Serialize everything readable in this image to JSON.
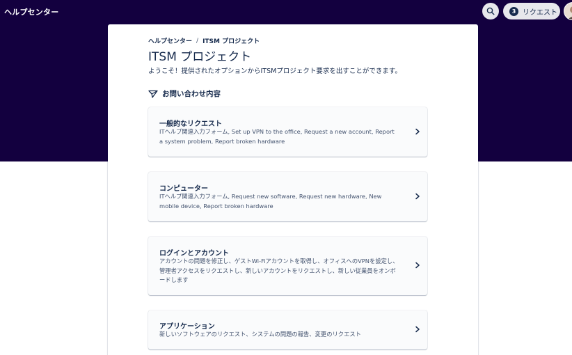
{
  "header": {
    "brand": "ヘルプセンター",
    "request_count": "3",
    "request_label": "リクエスト"
  },
  "breadcrumb": {
    "items": [
      "ヘルプセンター",
      "ITSM プロジェクト"
    ],
    "separator": "/"
  },
  "page": {
    "title": "ITSM プロジェクト",
    "welcome": "ようこそ！提供されたオプションからITSMプロジェクト要求を出すことができます。",
    "section_title": "お問い合わせ内容"
  },
  "categories": [
    {
      "title": "一般的なリクエスト",
      "description": "ITヘルプ関連入力フォーム, Set up VPN to the office, Request a new account, Report a system problem, Report broken hardware"
    },
    {
      "title": "コンピューター",
      "description": "ITヘルプ関連入力フォーム, Request new software, Request new hardware, New mobile device, Report broken hardware"
    },
    {
      "title": "ログインとアカウント",
      "description": "アカウントの問題を修正し、ゲストWi-Fiアカウントを取得し、オフィスへのVPNを設定し、管理者アクセスをリクエストし、新しいアカウントをリクエストし、新しい従業員をオンボードします"
    },
    {
      "title": "アプリケーション",
      "description": "新しいソフトウェアのリクエスト、システムの問題の報告、変更のリクエスト"
    }
  ],
  "colors": {
    "hero": "#13003f",
    "text": "#172b4d",
    "muted": "#42526e",
    "card": "#fafbfc"
  }
}
